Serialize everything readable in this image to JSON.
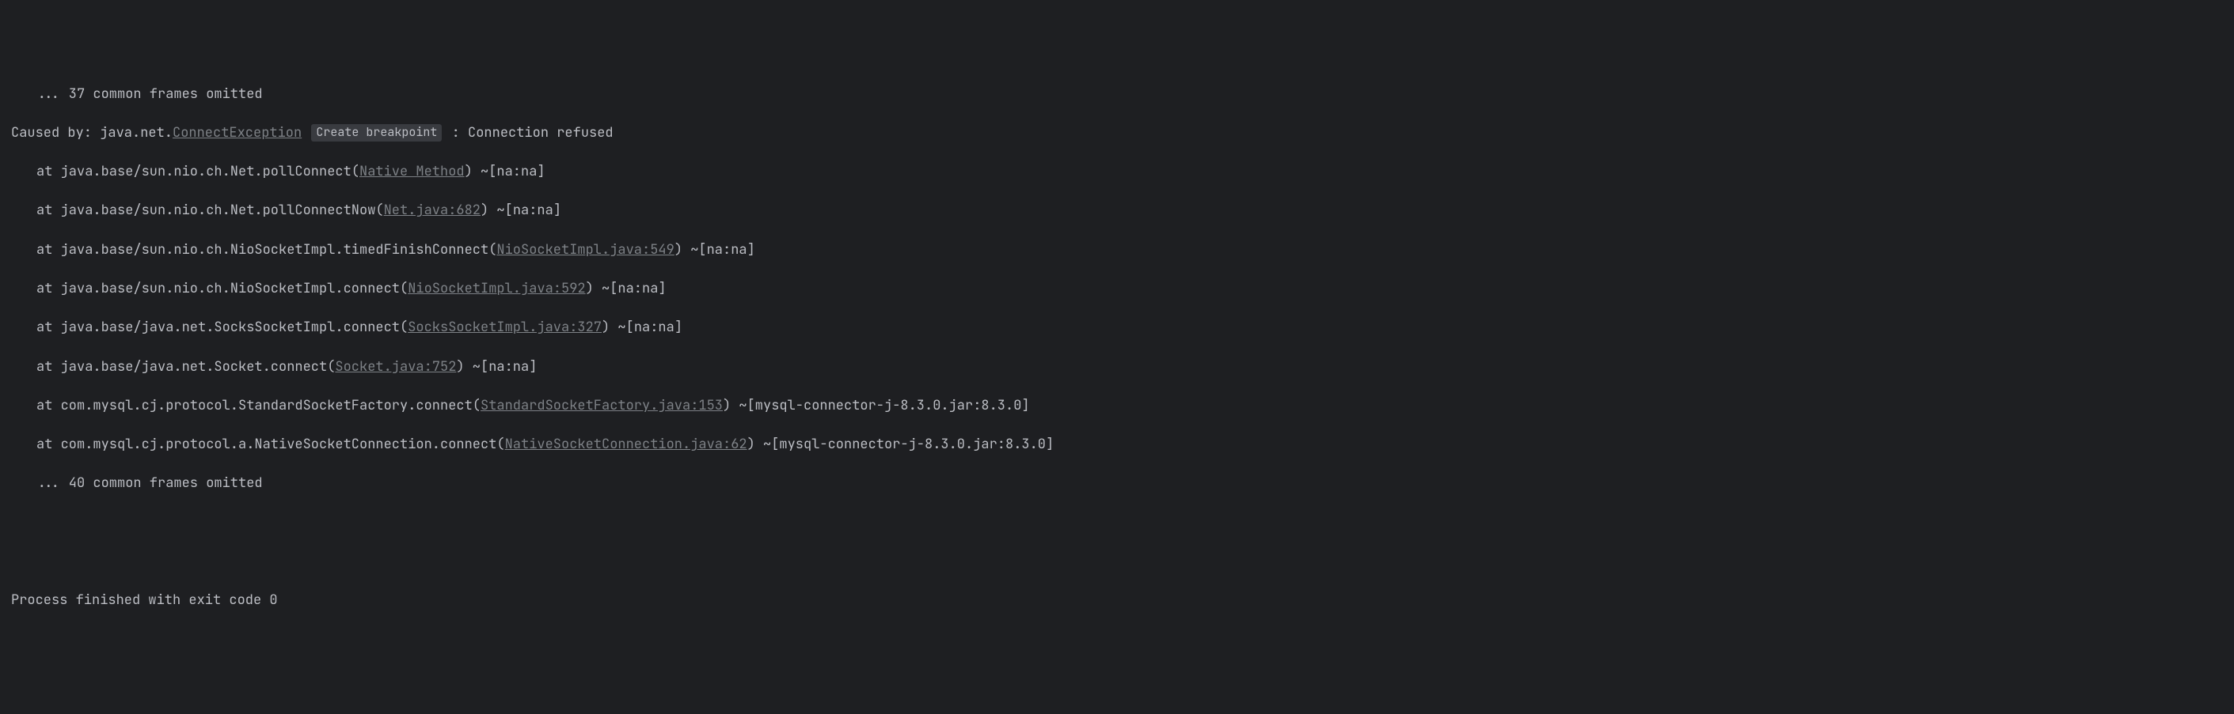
{
  "lines": {
    "omitted_top": "... 37 common frames omitted",
    "caused_by_prefix": "Caused by: java.net.",
    "caused_by_exception": "ConnectException",
    "breakpoint_label": "Create breakpoint",
    "caused_by_suffix": " : Connection refused",
    "traces": [
      {
        "prefix": "at java.base/sun.nio.ch.Net.pollConnect(",
        "link": "Native Method",
        "suffix": ") ~[na:na]"
      },
      {
        "prefix": "at java.base/sun.nio.ch.Net.pollConnectNow(",
        "link": "Net.java:682",
        "suffix": ") ~[na:na]"
      },
      {
        "prefix": "at java.base/sun.nio.ch.NioSocketImpl.timedFinishConnect(",
        "link": "NioSocketImpl.java:549",
        "suffix": ") ~[na:na]"
      },
      {
        "prefix": "at java.base/sun.nio.ch.NioSocketImpl.connect(",
        "link": "NioSocketImpl.java:592",
        "suffix": ") ~[na:na]"
      },
      {
        "prefix": "at java.base/java.net.SocksSocketImpl.connect(",
        "link": "SocksSocketImpl.java:327",
        "suffix": ") ~[na:na]"
      },
      {
        "prefix": "at java.base/java.net.Socket.connect(",
        "link": "Socket.java:752",
        "suffix": ") ~[na:na]"
      },
      {
        "prefix": "at com.mysql.cj.protocol.StandardSocketFactory.connect(",
        "link": "StandardSocketFactory.java:153",
        "suffix": ") ~[mysql-connector-j-8.3.0.jar:8.3.0]"
      },
      {
        "prefix": "at com.mysql.cj.protocol.a.NativeSocketConnection.connect(",
        "link": "NativeSocketConnection.java:62",
        "suffix": ") ~[mysql-connector-j-8.3.0.jar:8.3.0]"
      }
    ],
    "omitted_bottom": "... 40 common frames omitted",
    "process_finished": "Process finished with exit code 0"
  }
}
